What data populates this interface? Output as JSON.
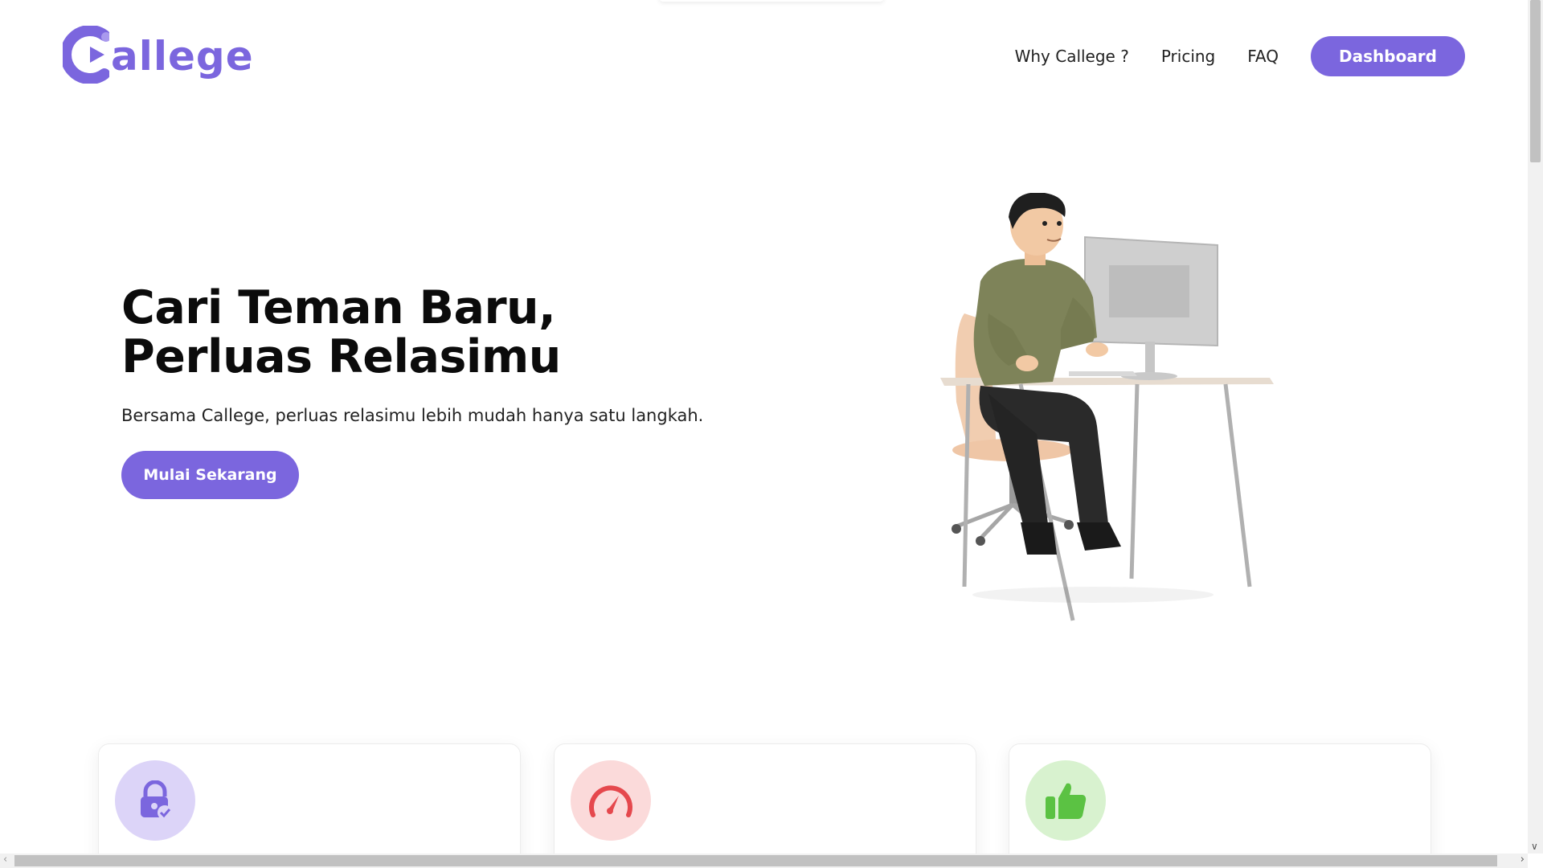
{
  "brand": {
    "name": "allege",
    "accent": "#7B66DE"
  },
  "nav": {
    "items": [
      "Why Callege ?",
      "Pricing",
      "FAQ"
    ],
    "dashboard_label": "Dashboard"
  },
  "hero": {
    "title": "Cari Teman Baru, Perluas Relasimu",
    "subtitle": "Bersama Callege, perluas relasimu lebih mudah hanya satu langkah.",
    "cta_label": "Mulai Sekarang",
    "illustration": "person-at-desk-illustration"
  },
  "features": [
    {
      "icon": "lock-check-icon",
      "bg": "#DCD4F8",
      "color": "#7B66DE"
    },
    {
      "icon": "speedometer-icon",
      "bg": "#FBDADA",
      "color": "#E5484D"
    },
    {
      "icon": "thumbs-up-icon",
      "bg": "#D8F2CF",
      "color": "#5BC243"
    }
  ]
}
